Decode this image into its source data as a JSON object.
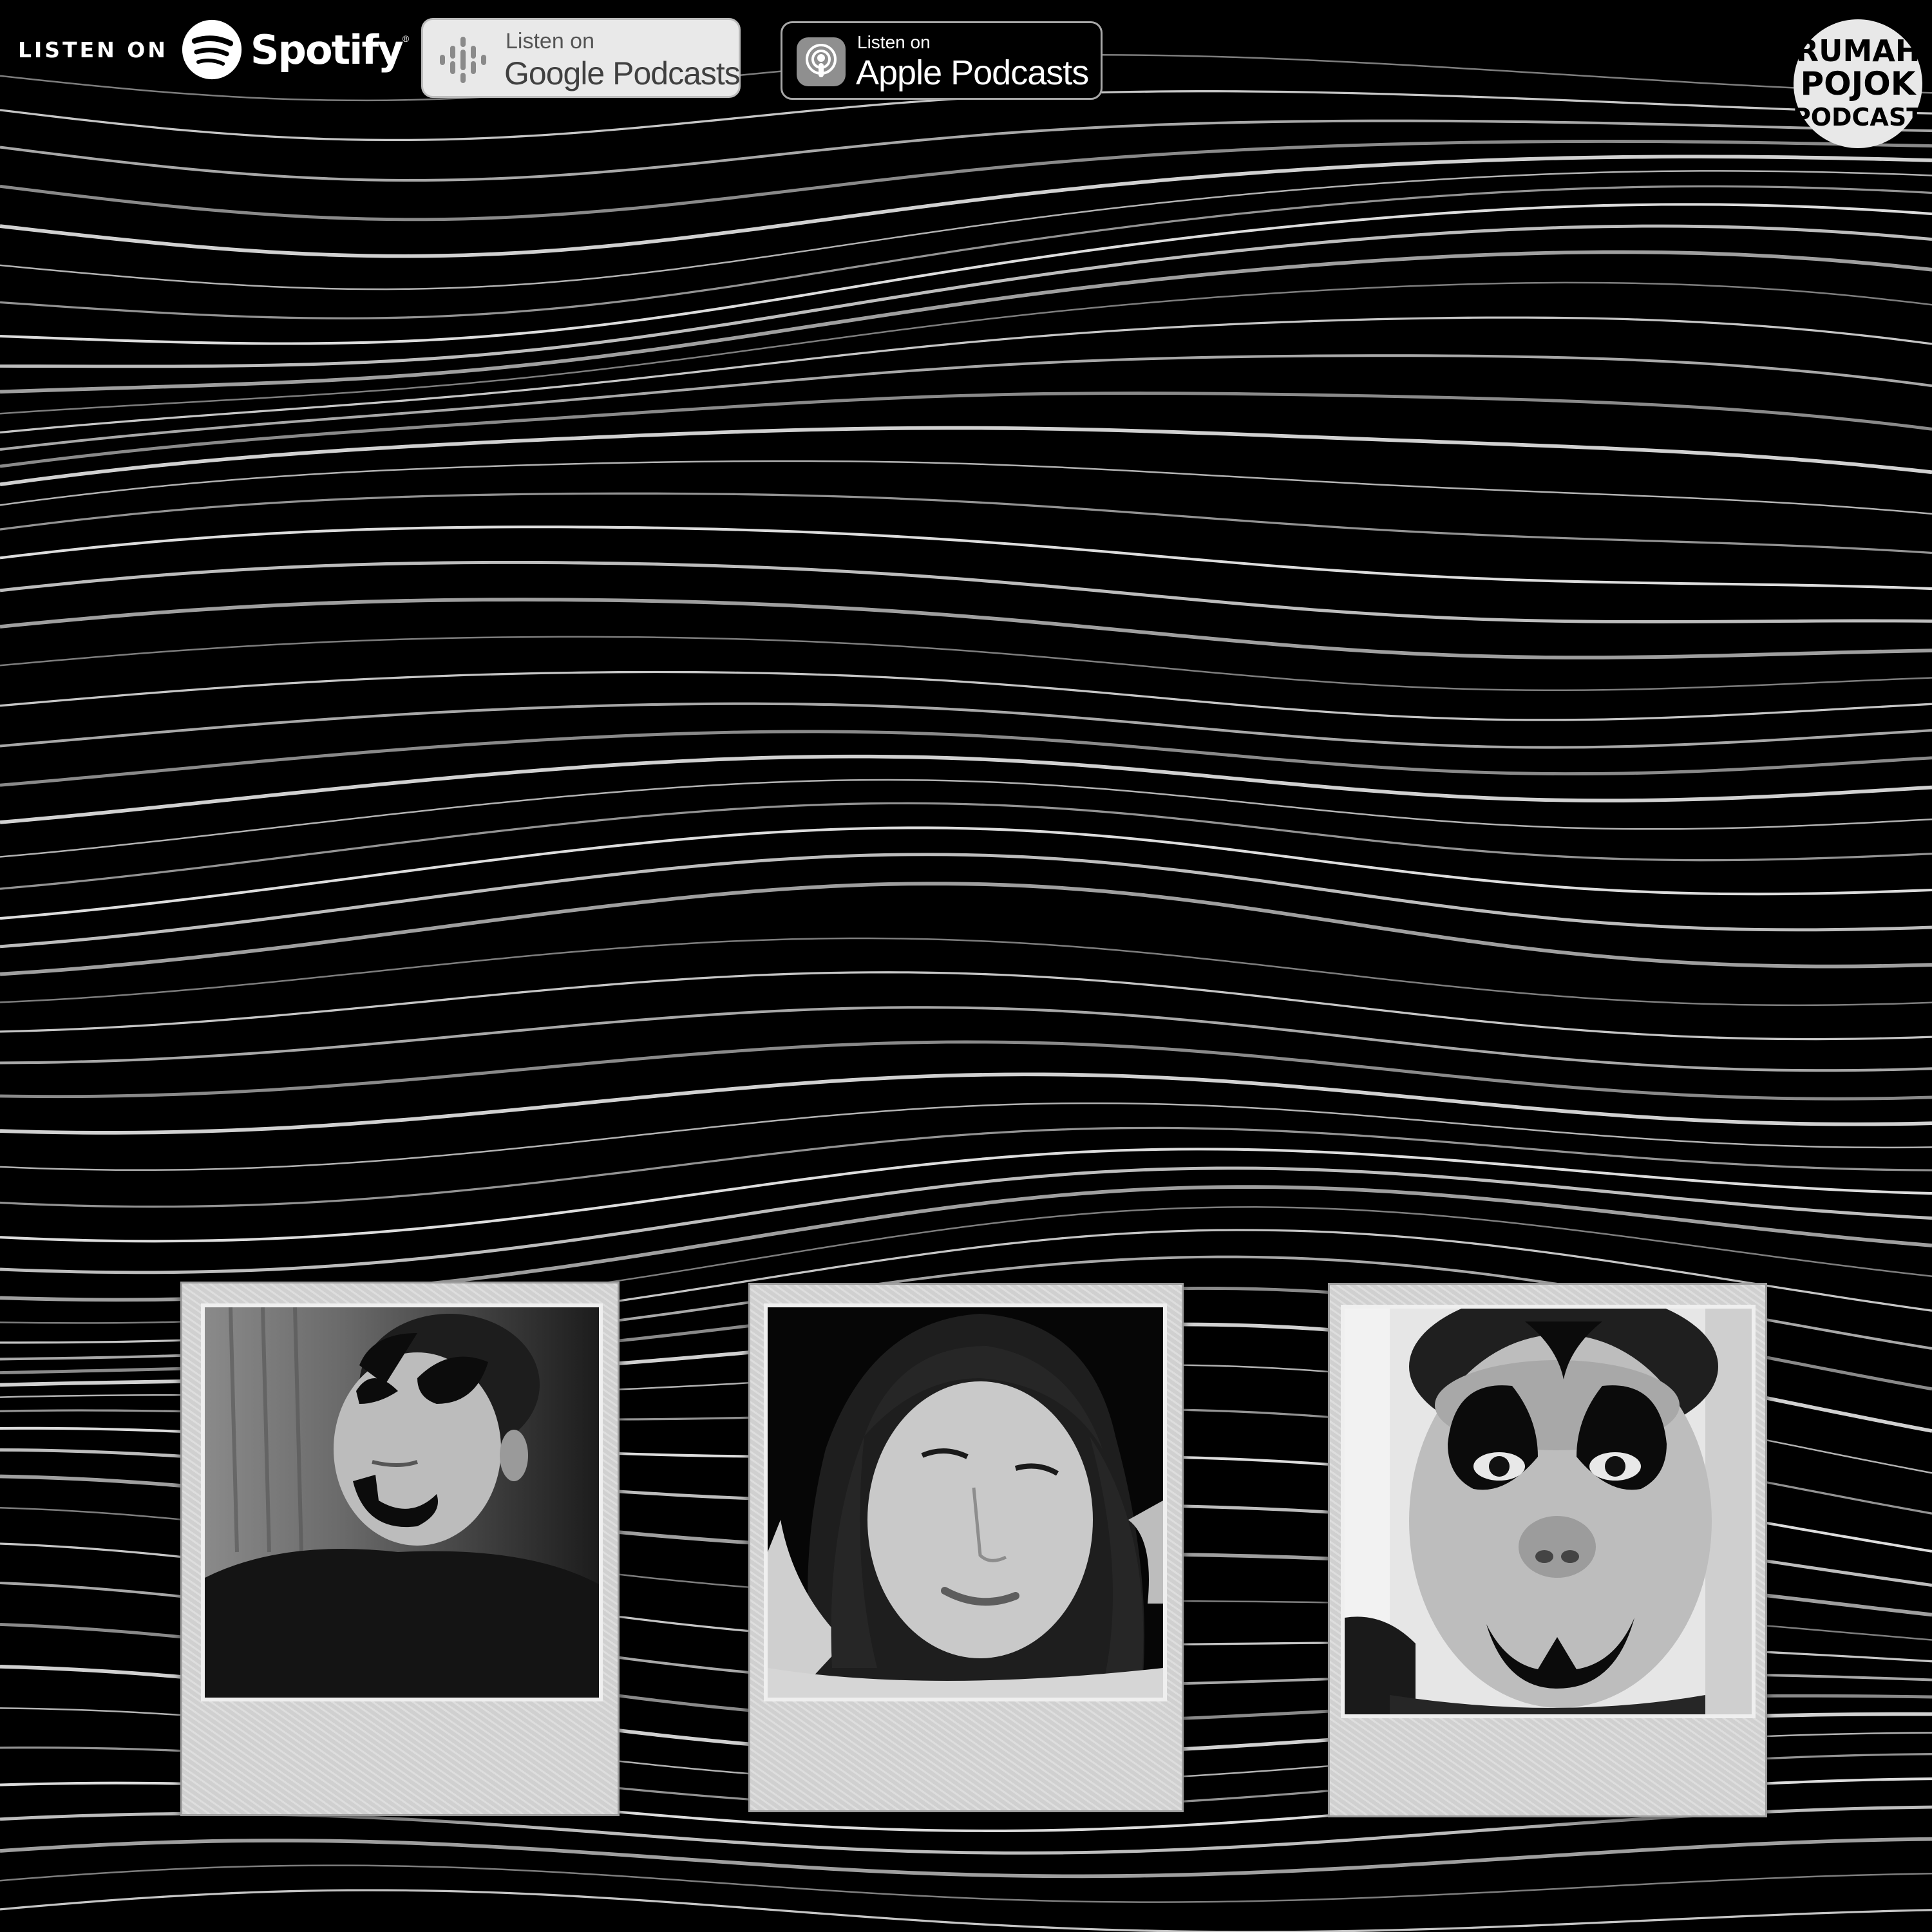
{
  "badges": {
    "spotify": {
      "prefix": "LISTEN ON",
      "brand": "Spotify",
      "mark": "®",
      "icon": "spotify-icon"
    },
    "google": {
      "small": "Listen on",
      "big": "Google Podcasts",
      "icon": "google-podcasts-icon"
    },
    "apple": {
      "small": "Listen on",
      "big": "Apple Podcasts",
      "icon": "apple-podcasts-icon"
    }
  },
  "logo": {
    "line1": "RUMAH",
    "line2": "POJOK",
    "line3": "PODCAST"
  },
  "colors": {
    "background": "#000000",
    "lines": "#e6e6e6",
    "frame": "#d9d9d9"
  },
  "polaroids": [
    {
      "subject": "host-left",
      "icon": "portrait-with-face-paint"
    },
    {
      "subject": "host-center",
      "icon": "portrait"
    },
    {
      "subject": "host-right",
      "icon": "portrait-with-face-paint"
    }
  ]
}
